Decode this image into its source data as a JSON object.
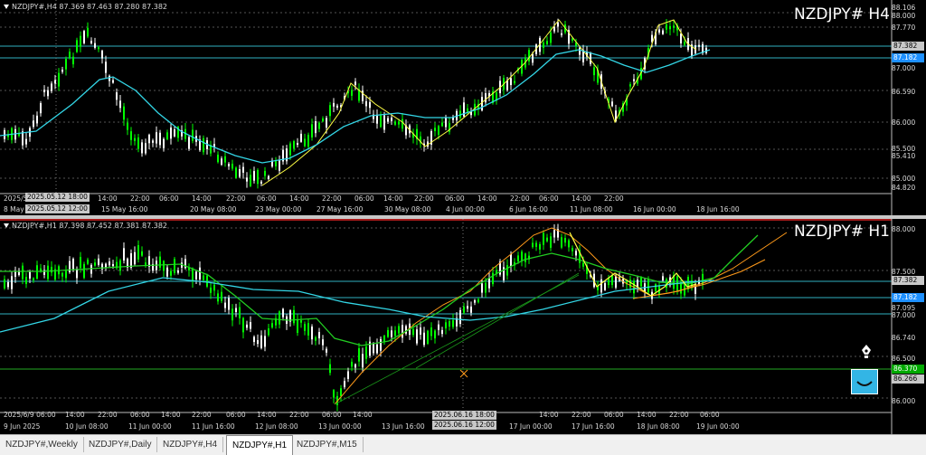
{
  "h4": {
    "header": "NZDJPY#,H4 87.369 87.463 87.280 87.382",
    "title": "NZDJPY# H4",
    "price_labels": [
      "88.106",
      "88.000",
      "87.770",
      "87.382",
      "87.182",
      "87.000",
      "86.590",
      "86.000",
      "85.500",
      "85.410",
      "85.000",
      "84.820"
    ],
    "highlight_price": "87.182",
    "current_price": "87.382",
    "x_labels": [
      "8 May 2025",
      "2025.05.12 12:00",
      "15 May 16:00",
      "20 May 08:00",
      "23 May 00:00",
      "27 May 16:00",
      "30 May 08:00",
      "4 Jun 00:00",
      "6 Jun 16:00",
      "11 Jun 08:00",
      "16 Jun 00:00",
      "18 Jun 16:00"
    ],
    "x_labels_upper": [
      "2025/5",
      "2025.05.12 18:00",
      "14:00",
      "22:00",
      "06:00",
      "14:00",
      "22:00",
      "06:00",
      "14:00",
      "22:00",
      "06:00",
      "14:00",
      "22:00",
      "06:00",
      "14:00",
      "22:00",
      "06:00",
      "14:00",
      "22:00"
    ],
    "tag_primary": "2025.05.12 18:00",
    "tag_secondary": "2025.05.12 12:00"
  },
  "h1": {
    "header": "NZDJPY#,H1 87.398 87.452 87.381 87.382",
    "title": "NZDJPY# H1",
    "price_labels": [
      "88.000",
      "87.500",
      "87.382",
      "87.182",
      "87.095",
      "87.000",
      "86.740",
      "86.500",
      "86.370",
      "86.266",
      "86.000"
    ],
    "highlight_price": "87.182",
    "green_price": "86.370",
    "current_price": "87.382",
    "x_labels": [
      "9 Jun 2025",
      "10 Jun 08:00",
      "11 Jun 00:00",
      "11 Jun 16:00",
      "12 Jun 08:00",
      "13 Jun 00:00",
      "13 Jun 16:00",
      "2025.06.16 12:00",
      "17 Jun 00:00",
      "17 Jun 16:00",
      "18 Jun 08:00",
      "19 Jun 00:00"
    ],
    "x_labels_upper": [
      "2025/6/9 06:00",
      "14:00",
      "22:00",
      "06:00",
      "14:00",
      "22:00",
      "06:00",
      "14:00",
      "22:00",
      "06:00",
      "14:00",
      "2025.06.16 18:00",
      "14:00",
      "22:00",
      "06:00",
      "14:00",
      "22:00",
      "06:00"
    ],
    "tag_primary": "2025.06.16 18:00",
    "tag_secondary": "2025.06.16 12:00"
  },
  "tabs": [
    {
      "label": "NZDJPY#,Weekly",
      "active": false
    },
    {
      "label": "NZDJPY#,Daily",
      "active": false
    },
    {
      "label": "NZDJPY#,H4",
      "active": false
    },
    {
      "label": "NZDJPY#,H1",
      "active": true
    },
    {
      "label": "NZDJPY#,M15",
      "active": false
    }
  ],
  "icons": {
    "pen": "fountain-pen-icon",
    "badge": "smile-badge-icon"
  },
  "colors": {
    "bull": "#00ff00",
    "bear": "#ffffff",
    "ma_fast": "#ffff44",
    "ma_slow": "#33d6e6",
    "ma_mid": "#22cc22",
    "trend": "#ff9a1a",
    "grid": "#555555",
    "hline": "#2fb0c0",
    "highlight": "#1e90ff",
    "green_tag": "#00aa00"
  }
}
